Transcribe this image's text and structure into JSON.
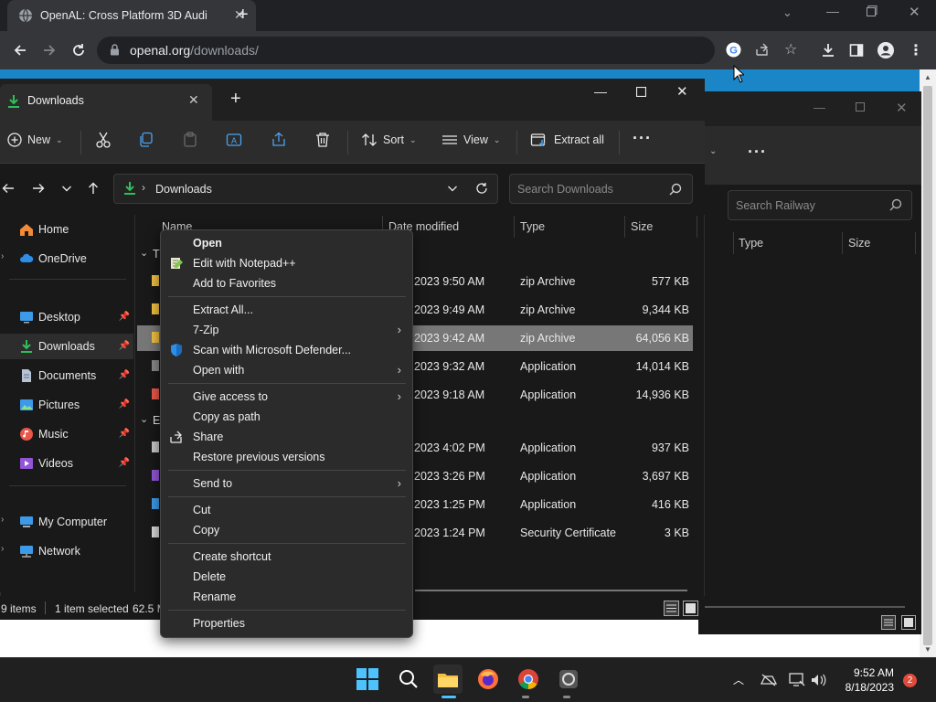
{
  "browser": {
    "tab_title": "OpenAL: Cross Platform 3D Audi",
    "url_host": "openal.org",
    "url_path": "/downloads/"
  },
  "bg_window": {
    "search_placeholder": "Search Railway",
    "col_type": "Type",
    "col_size": "Size"
  },
  "explorer": {
    "tab_title": "Downloads",
    "toolbar": {
      "new": "New",
      "sort": "Sort",
      "view": "View",
      "extract_all": "Extract all"
    },
    "address": "Downloads",
    "search_placeholder": "Search Downloads",
    "columns": {
      "name": "Name",
      "date": "Date modified",
      "type": "Type",
      "size": "Size"
    },
    "group_labels": [
      "T",
      "E"
    ],
    "nav": [
      {
        "label": "Home"
      },
      {
        "label": "OneDrive"
      },
      {
        "label": "Desktop"
      },
      {
        "label": "Downloads"
      },
      {
        "label": "Documents"
      },
      {
        "label": "Pictures"
      },
      {
        "label": "Music"
      },
      {
        "label": "Videos"
      },
      {
        "label": "My Computer"
      },
      {
        "label": "Network"
      }
    ],
    "rows": [
      {
        "date": "2023 9:50 AM",
        "type": "zip Archive",
        "size": "577 KB"
      },
      {
        "date": "2023 9:49 AM",
        "type": "zip Archive",
        "size": "9,344 KB"
      },
      {
        "date": "2023 9:42 AM",
        "type": "zip Archive",
        "size": "64,056 KB"
      },
      {
        "date": "2023 9:32 AM",
        "type": "Application",
        "size": "14,014 KB"
      },
      {
        "date": "2023 9:18 AM",
        "type": "Application",
        "size": "14,936 KB"
      },
      {
        "date": "2023 4:02 PM",
        "type": "Application",
        "size": "937 KB"
      },
      {
        "date": "2023 3:26 PM",
        "type": "Application",
        "size": "3,697 KB"
      },
      {
        "date": "2023 1:25 PM",
        "type": "Application",
        "size": "416 KB"
      },
      {
        "date": "2023 1:24 PM",
        "type": "Security Certificate",
        "size": "3 KB"
      }
    ],
    "status": {
      "items": "9 items",
      "selected": "1 item selected",
      "size": "62.5 M"
    }
  },
  "context_menu": {
    "open": "Open",
    "edit_notepad": "Edit with Notepad++",
    "add_favorites": "Add to Favorites",
    "extract_all": "Extract All...",
    "seven_zip": "7-Zip",
    "scan_defender": "Scan with Microsoft Defender...",
    "open_with": "Open with",
    "give_access": "Give access to",
    "copy_path": "Copy as path",
    "share": "Share",
    "restore": "Restore previous versions",
    "send_to": "Send to",
    "cut": "Cut",
    "copy": "Copy",
    "create_shortcut": "Create shortcut",
    "delete": "Delete",
    "rename": "Rename",
    "properties": "Properties"
  },
  "taskbar": {
    "time": "9:52 AM",
    "date": "8/18/2023",
    "badge": "2"
  }
}
